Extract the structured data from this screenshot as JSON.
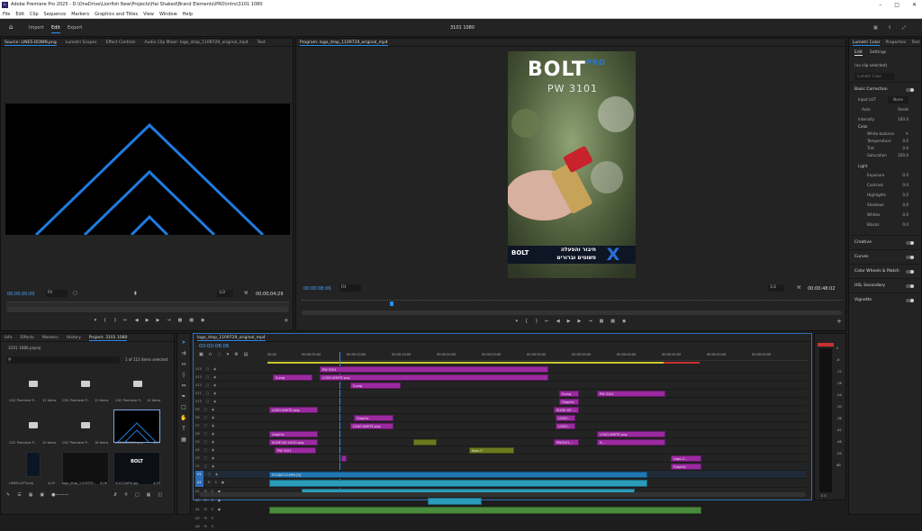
{
  "titlebar": {
    "text": "Adobe Premiere Pro 2025 - D:\\OneDrive\\Lionfish New\\Projects\\Hai Shaked\\Brand Elements\\PRO\\intro\\3101 1080"
  },
  "menu": [
    "File",
    "Edit",
    "Clip",
    "Sequence",
    "Markers",
    "Graphics and Titles",
    "View",
    "Window",
    "Help"
  ],
  "workspace": {
    "tabs": [
      "Import",
      "Edit",
      "Export"
    ],
    "active": "Edit",
    "sequence_name": "3101 1080"
  },
  "source": {
    "tabs": [
      "Source: LINES-DOWN.png",
      "Lumetri Scopes",
      "Effect Controls",
      "Audio Clip Mixer: logo_drop_1109729_original_mp4",
      "Text"
    ],
    "timecode": "00;00;00;00",
    "fit": "Fit",
    "res": "1/2",
    "duration": "00;00;04;29"
  },
  "program": {
    "tab": "Program: logo_drop_1109729_original_mp4",
    "timecode": "00:00:08:06",
    "fit": "Fit",
    "res": "1/2",
    "duration": "00:00:48:02",
    "brand": "BOLT",
    "brand_sub": "PRO",
    "product": "PW 3101",
    "heb1": "חיבור והפעלה",
    "heb2": "פשוטים וברורים",
    "badge": "BOLT"
  },
  "project": {
    "tabs": [
      "Info",
      "Effects",
      "Markers",
      "History",
      "Project: 3101 1080"
    ],
    "file": "3101 1080.prproj",
    "count": "1 of 113 items selected",
    "items": [
      {
        "label": "CGC Premiere P...",
        "meta": "12 items"
      },
      {
        "label": "CGC Premiere P...",
        "meta": "11 items"
      },
      {
        "label": "CGC Premiere P...",
        "meta": "10 items"
      },
      {
        "label": "CGC Premiere P...",
        "meta": "10 items"
      },
      {
        "label": "CGC Premiere P...",
        "meta": "16 items"
      },
      {
        "label": "LINES-DOWN.png",
        "meta": "4;29"
      },
      {
        "label": "LINES-LEFT.png",
        "meta": "4;29"
      },
      {
        "label": "logo_drop_1109729...",
        "meta": "0;06"
      },
      {
        "label": "SLID-DARK.jpg",
        "meta": "4;29"
      }
    ]
  },
  "timeline": {
    "tab": "logo_drop_1109729_original_mp4",
    "timecode": "00:00:08:06",
    "ruler": [
      "00:00",
      "00:00:05:00",
      "00:00:10:00",
      "00:00:15:00",
      "00:00:20:00",
      "00:00:25:00",
      "00:00:30:00",
      "00:00:35:00",
      "00:00:40:00",
      "00:00:45:00",
      "00:00:50:00",
      "00:00:55:00"
    ],
    "video_tracks": [
      "V14",
      "V13",
      "V12",
      "V11",
      "V10",
      "V9",
      "V8",
      "V7",
      "V6",
      "V5",
      "V4",
      "V3",
      "V2",
      "V1"
    ],
    "audio_tracks": [
      "A1",
      "A2",
      "A3",
      "A4",
      "A5",
      "A6"
    ],
    "clips": {
      "pw3101": "PW 3101",
      "logowhite": "LOGO-WHITE.png",
      "xpng": "X.png",
      "graphic": "Graphic",
      "slide_no_logo": "SLIDE NO LOGO.png",
      "p1180": "P1180713.MP4 [V]",
      "p1180b": "P1180...",
      "p1180c": "P1180791...",
      "p1180d": "P1180719.M...",
      "logo2": "Logo-2...",
      "slide_no": "SLIDE NO ...",
      "logo": "LOGO...",
      "lines3": "lines 3",
      "p1180e": "P1180...",
      "pw3101b": "PW3101...",
      "x2": "X..."
    }
  },
  "meter": {
    "labels": [
      "0",
      "-6",
      "-12",
      "-18",
      "-24",
      "-30",
      "-36",
      "-42",
      "-48",
      "-54",
      "dB"
    ],
    "bottom": "S S"
  },
  "lumetri": {
    "tabs": [
      "Lumetri Color",
      "Properties",
      "Text"
    ],
    "sub_tabs": [
      "Edit",
      "Settings"
    ],
    "no_clip": "(no clip selected)",
    "preset": "Lumetri Color",
    "basic": "Basic Correction",
    "input_lut": "Input LUT",
    "lut_val": "None",
    "auto": "Auto",
    "reset": "Reset",
    "intensity": "Intensity",
    "color": "Color",
    "white_balance": "White balance",
    "temperature": "Temperature",
    "tint": "Tint",
    "saturation": "Saturation",
    "light": "Light",
    "light_rows": [
      "Exposure",
      "Contrast",
      "Highlights",
      "Shadows",
      "Whites",
      "Blacks"
    ],
    "sections": [
      "Creative",
      "Curves",
      "Color Wheels & Match",
      "HSL Secondary",
      "Vignette"
    ],
    "val_zero": "0.0",
    "val_sat": "100.0",
    "val_int": "100.0"
  }
}
